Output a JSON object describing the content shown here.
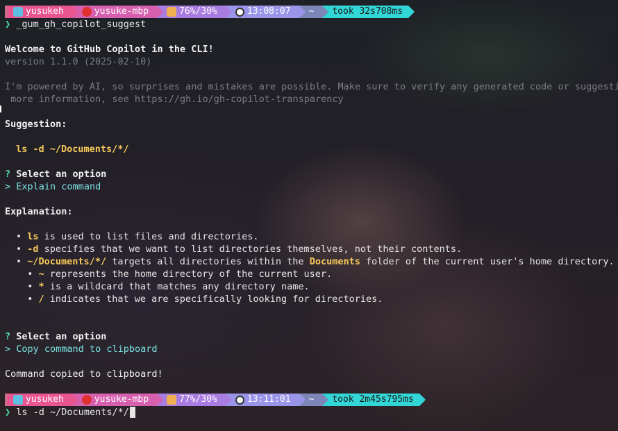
{
  "prompt1": {
    "user": "yusukeh",
    "host": "yusuke-mbp",
    "battery": "76%/30%",
    "time": "13:08:07",
    "dir": "~",
    "took": "took 32s708ms"
  },
  "command1": "_gum_gh_copilot_suggest",
  "prompt_char": "❯",
  "welcome": "Welcome to GitHub Copilot in the CLI!",
  "version": "version 1.1.0 (2025-02-10)",
  "disclaimer1": "I'm powered by AI, so surprises and mistakes are possible. Make sure to verify any generated code or suggestion",
  "disclaimer2": " more information, see https://gh.io/gh-copilot-transparency",
  "suggestion_label": "Suggestion:",
  "suggestion_cmd": "ls -d ~/Documents/*/",
  "select1": {
    "q": "?",
    "label": "Select an option",
    "arrow": ">",
    "choice": "Explain command"
  },
  "explanation_label": "Explanation:",
  "bullets": [
    {
      "parts": [
        [
          "•",
          ""
        ],
        [
          " ",
          ""
        ],
        [
          "ls",
          "y"
        ],
        [
          " is used to list files and directories.",
          ""
        ]
      ]
    },
    {
      "parts": [
        [
          "•",
          ""
        ],
        [
          " ",
          ""
        ],
        [
          "-d",
          "y"
        ],
        [
          " specifies that we want to list directories themselves, not their contents.",
          ""
        ]
      ]
    },
    {
      "parts": [
        [
          "•",
          ""
        ],
        [
          " ",
          ""
        ],
        [
          "~/Documents/*/",
          "y"
        ],
        [
          " targets all directories within the ",
          ""
        ],
        [
          "Documents",
          "y"
        ],
        [
          " folder of the current user's home directory.",
          ""
        ]
      ]
    },
    {
      "parts": [
        [
          "  •",
          ""
        ],
        [
          " ",
          ""
        ],
        [
          "~",
          "y"
        ],
        [
          " represents the home directory of the current user.",
          ""
        ]
      ]
    },
    {
      "parts": [
        [
          "  •",
          ""
        ],
        [
          " ",
          ""
        ],
        [
          "*",
          "y"
        ],
        [
          " is a wildcard that matches any directory name.",
          ""
        ]
      ]
    },
    {
      "parts": [
        [
          "  •",
          ""
        ],
        [
          " ",
          ""
        ],
        [
          "/",
          "y"
        ],
        [
          " indicates that we are specifically looking for directories.",
          ""
        ]
      ]
    }
  ],
  "select2": {
    "q": "?",
    "label": "Select an option",
    "arrow": ">",
    "choice": "Copy command to clipboard"
  },
  "copied": "Command copied to clipboard!",
  "prompt2": {
    "user": "yusukeh",
    "host": "yusuke-mbp",
    "battery": "77%/30%",
    "time": "13:11:01",
    "dir": "~",
    "took": "took 2m45s795ms"
  },
  "command2": "ls -d ~/Documents/*/",
  "colors": {
    "pink": "#e8558f",
    "magenta": "#d65fae",
    "purple": "#a87ce0",
    "lavender": "#9a95e8",
    "slate": "#7c86b8",
    "cyan": "#33d6d6",
    "yellow": "#f5c85a",
    "green": "#4ee0a8"
  }
}
